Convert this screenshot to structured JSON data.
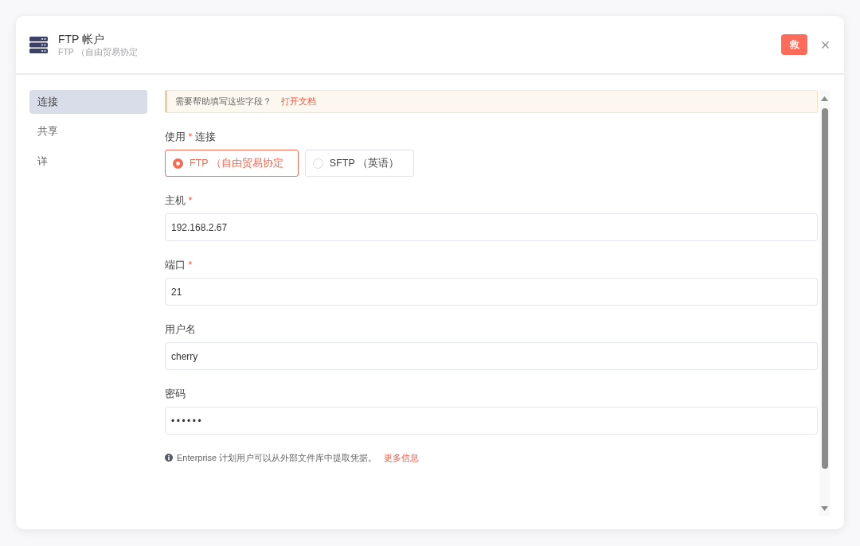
{
  "dialog": {
    "title": "FTP 帐户",
    "subtitle": "FTP （自由贸易协定",
    "save_button": "救"
  },
  "sidebar": {
    "items": [
      {
        "label": "连接",
        "selected": true
      },
      {
        "label": "共享",
        "selected": false
      },
      {
        "label": "详",
        "selected": false
      }
    ]
  },
  "help_banner": {
    "text": "需要帮助填写这些字段？",
    "link": "打开文档"
  },
  "connection": {
    "label": "使用",
    "required_mark": "*",
    "label_end": "连接",
    "options": [
      {
        "label": "FTP （自由贸易协定",
        "selected": true
      },
      {
        "label": "SFTP （英语）",
        "selected": false
      }
    ]
  },
  "fields": [
    {
      "label": "主机",
      "required_mark": "*",
      "kind": "text",
      "value": "192.168.2.67"
    },
    {
      "label": "端口",
      "required_mark": "*",
      "kind": "text",
      "value": "21"
    },
    {
      "label": "用户名",
      "kind": "text",
      "value": "cherry"
    },
    {
      "label": "密码",
      "kind": "password",
      "value": "••••••"
    }
  ],
  "note": {
    "text": "Enterprise 计划用户可以从外部文件库中提取凭据。",
    "link": "更多信息"
  }
}
